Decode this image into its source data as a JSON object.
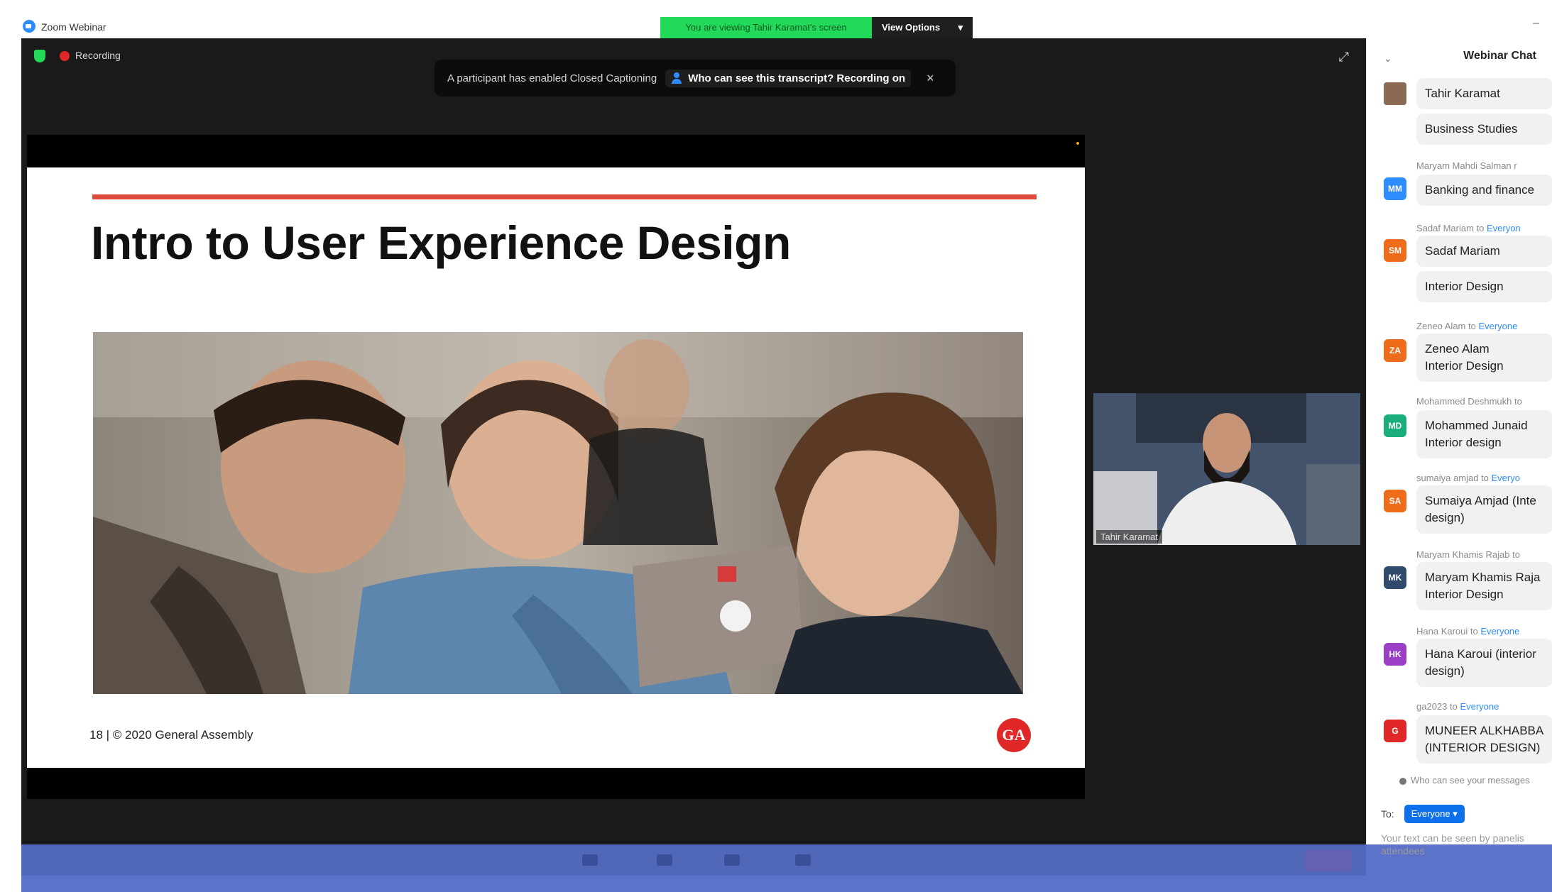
{
  "window": {
    "title": "Zoom Webinar"
  },
  "share_banner": {
    "viewing_text": "You are viewing Tahir Karamat's screen",
    "view_options": "View Options",
    "dropdown_glyph": "▾"
  },
  "status": {
    "recording_label": "Recording"
  },
  "cc_banner": {
    "text": "A participant has enabled Closed Captioning",
    "link": "Who can see this transcript? Recording on",
    "close": "×"
  },
  "slide": {
    "title": "Intro to User Experience Design",
    "footer": "18 | © 2020 General Assembly",
    "logo": "GA",
    "accent_color": "#e04a3c"
  },
  "video": {
    "name": "Tahir Karamat"
  },
  "chat": {
    "title": "Webinar Chat",
    "messages": [
      {
        "header": "",
        "to": "",
        "avatar": "",
        "lines": [
          "Tahir Karamat"
        ]
      },
      {
        "header": "",
        "to": "",
        "avatar": "",
        "lines": [
          "Business Studies"
        ]
      },
      {
        "header": "Maryam Mahdi Salman r",
        "to": "",
        "avatar": "MM",
        "lines": [
          "Banking and finance"
        ]
      },
      {
        "header": "Sadaf Mariam to ",
        "to": "Everyon",
        "avatar": "SM",
        "lines": [
          "Sadaf Mariam"
        ]
      },
      {
        "header": "",
        "to": "",
        "avatar": "",
        "lines": [
          "Interior Design"
        ]
      },
      {
        "header": "Zeneo Alam to ",
        "to": "Everyone",
        "avatar": "ZA",
        "lines": [
          "Zeneo Alam",
          "Interior Design"
        ]
      },
      {
        "header": "Mohammed Deshmukh to",
        "to": "",
        "avatar": "MD",
        "lines": [
          "Mohammed Junaid",
          "Interior design"
        ]
      },
      {
        "header": "sumaiya amjad to ",
        "to": "Everyo",
        "avatar": "SA",
        "lines": [
          "Sumaiya Amjad (Inte",
          "design)"
        ]
      },
      {
        "header": "Maryam Khamis Rajab to",
        "to": "",
        "avatar": "MK",
        "lines": [
          "Maryam Khamis Raja",
          "Interior Design"
        ]
      },
      {
        "header": "Hana Karoui to ",
        "to": "Everyone",
        "avatar": "HK",
        "lines": [
          "Hana Karoui (interior",
          "design)"
        ]
      },
      {
        "header": "ga2023 to ",
        "to": "Everyone",
        "avatar": "G",
        "lines": [
          "MUNEER ALKHABBA",
          "(INTERIOR DESIGN)"
        ]
      }
    ],
    "footer_note": "Who can see your messages",
    "to_label": "To:",
    "to_value": "Everyone ▾",
    "hint": "Your text can be seen by panelis attendees"
  },
  "colors": {
    "brand_blue": "#2d8cff",
    "banner_green": "#23d959",
    "recording_red": "#e02828",
    "avatar_MM": "#2d8cff",
    "avatar_SM": "#ef6c1a",
    "avatar_ZA": "#ef6c1a",
    "avatar_MD": "#1aae7a",
    "avatar_SA": "#ef6c1a",
    "avatar_MK": "#2f4a6b",
    "avatar_HK": "#9b3fc8",
    "avatar_G": "#e02828"
  }
}
